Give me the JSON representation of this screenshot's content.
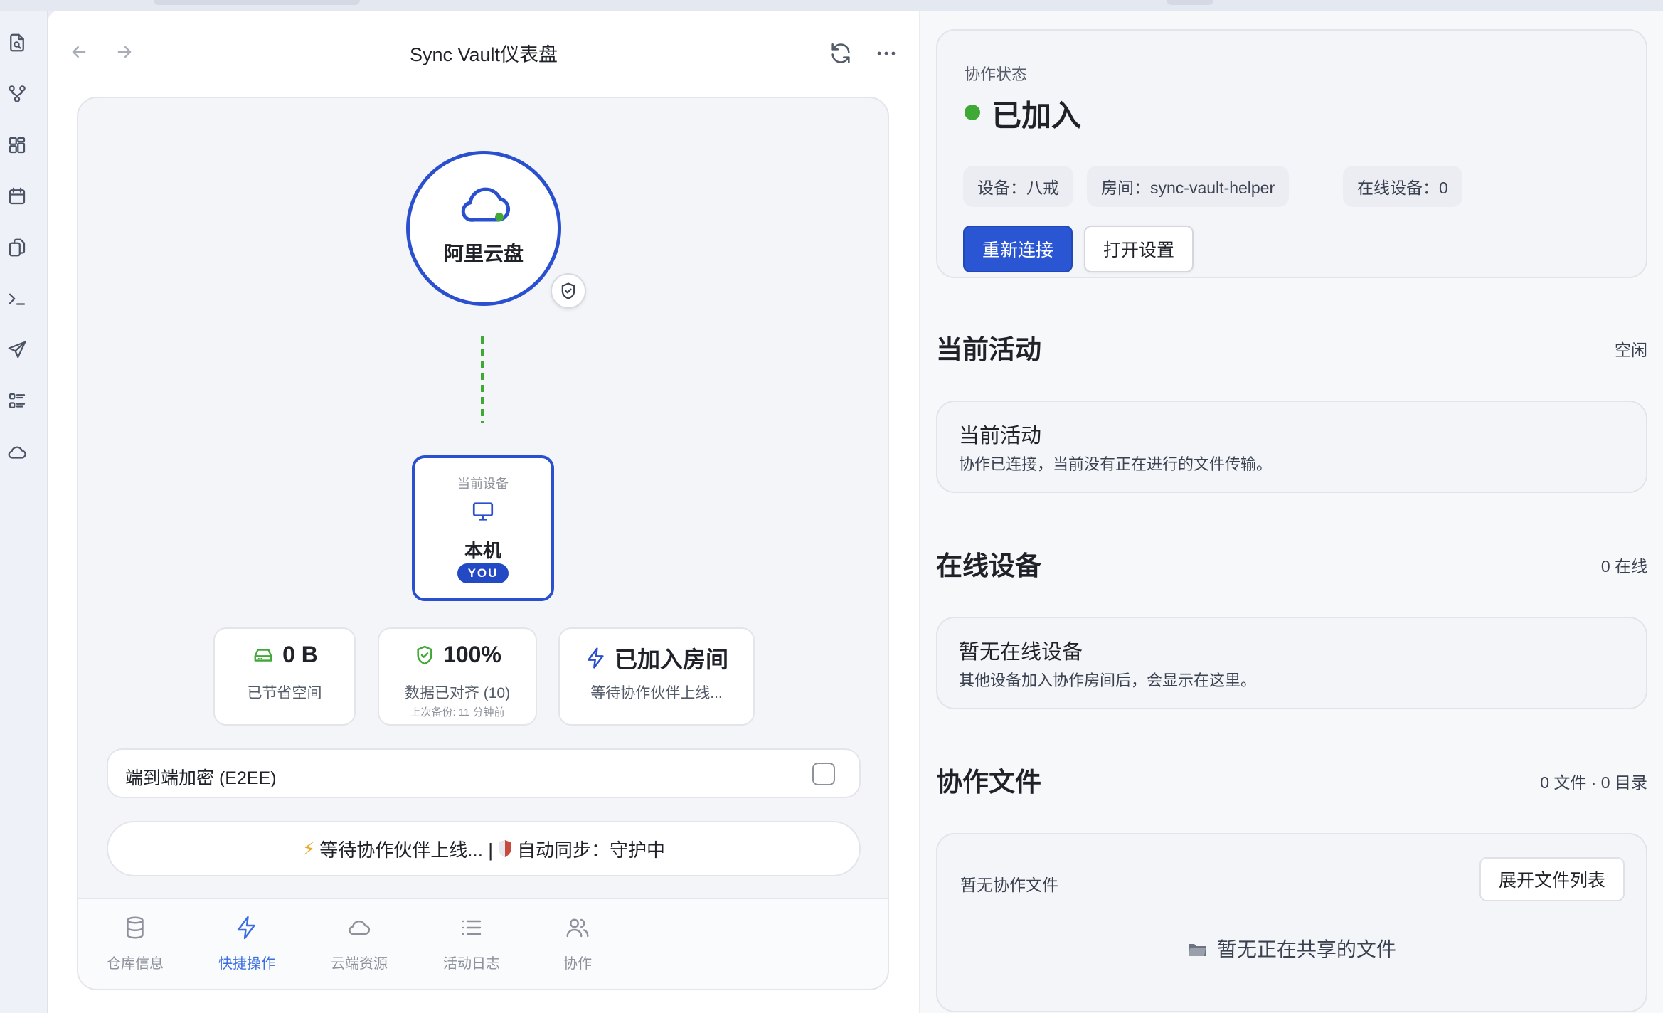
{
  "window": {
    "title": "Sync Vault仪表盘"
  },
  "ribbon": {
    "icons": [
      "file-search-icon",
      "git-branch-icon",
      "layout-grid-icon",
      "calendar-icon",
      "copy-files-icon",
      "terminal-icon",
      "send-icon",
      "list-icon",
      "cloud-icon"
    ]
  },
  "vault": {
    "cloud_name": "阿里云盘",
    "device": {
      "caption": "当前设备",
      "name": "本机",
      "badge": "YOU"
    },
    "stats": {
      "saved": {
        "value": "0 B",
        "label": "已节省空间"
      },
      "aligned": {
        "value": "100%",
        "label": "数据已对齐 (10)",
        "note": "上次备份: 11 分钟前"
      },
      "room": {
        "value": "已加入房间",
        "label": "等待协作伙伴上线..."
      }
    },
    "e2ee": {
      "label": "端到端加密 (E2EE)",
      "checked": false
    },
    "status_line": {
      "part1": "等待协作伙伴上线... |",
      "part2": "自动同步：守护中"
    },
    "bottom_nav": [
      {
        "label": "仓库信息",
        "icon": "database-icon",
        "active": false
      },
      {
        "label": "快捷操作",
        "icon": "lightning-icon",
        "active": true
      },
      {
        "label": "云端资源",
        "icon": "cloud-icon",
        "active": false
      },
      {
        "label": "活动日志",
        "icon": "list-icon",
        "active": false
      },
      {
        "label": "协作",
        "icon": "users-icon",
        "active": false
      }
    ]
  },
  "collab": {
    "status_label": "协作状态",
    "status": "已加入",
    "status_color": "#3fa935",
    "chips": {
      "device": "设备：八戒",
      "room": "房间：sync-vault-helper",
      "online": "在线设备：0"
    },
    "reconnect_label": "重新连接",
    "settings_label": "打开设置"
  },
  "activity": {
    "title": "当前活动",
    "meta": "空闲",
    "card_title": "当前活动",
    "card_desc": "协作已连接，当前没有正在进行的文件传输。"
  },
  "online_devices": {
    "title": "在线设备",
    "meta": "0 在线",
    "card_title": "暂无在线设备",
    "card_desc": "其他设备加入协作房间后，会显示在这里。"
  },
  "collab_files": {
    "title": "协作文件",
    "meta": "0 文件 · 0 目录",
    "empty_label": "暂无协作文件",
    "expand_label": "展开文件列表",
    "no_shared": "暂无正在共享的文件"
  },
  "colors": {
    "accent": "#2b50cf",
    "primary_button": "#2a55d3",
    "success": "#3fa935",
    "active_tab": "#3b6fe0"
  }
}
